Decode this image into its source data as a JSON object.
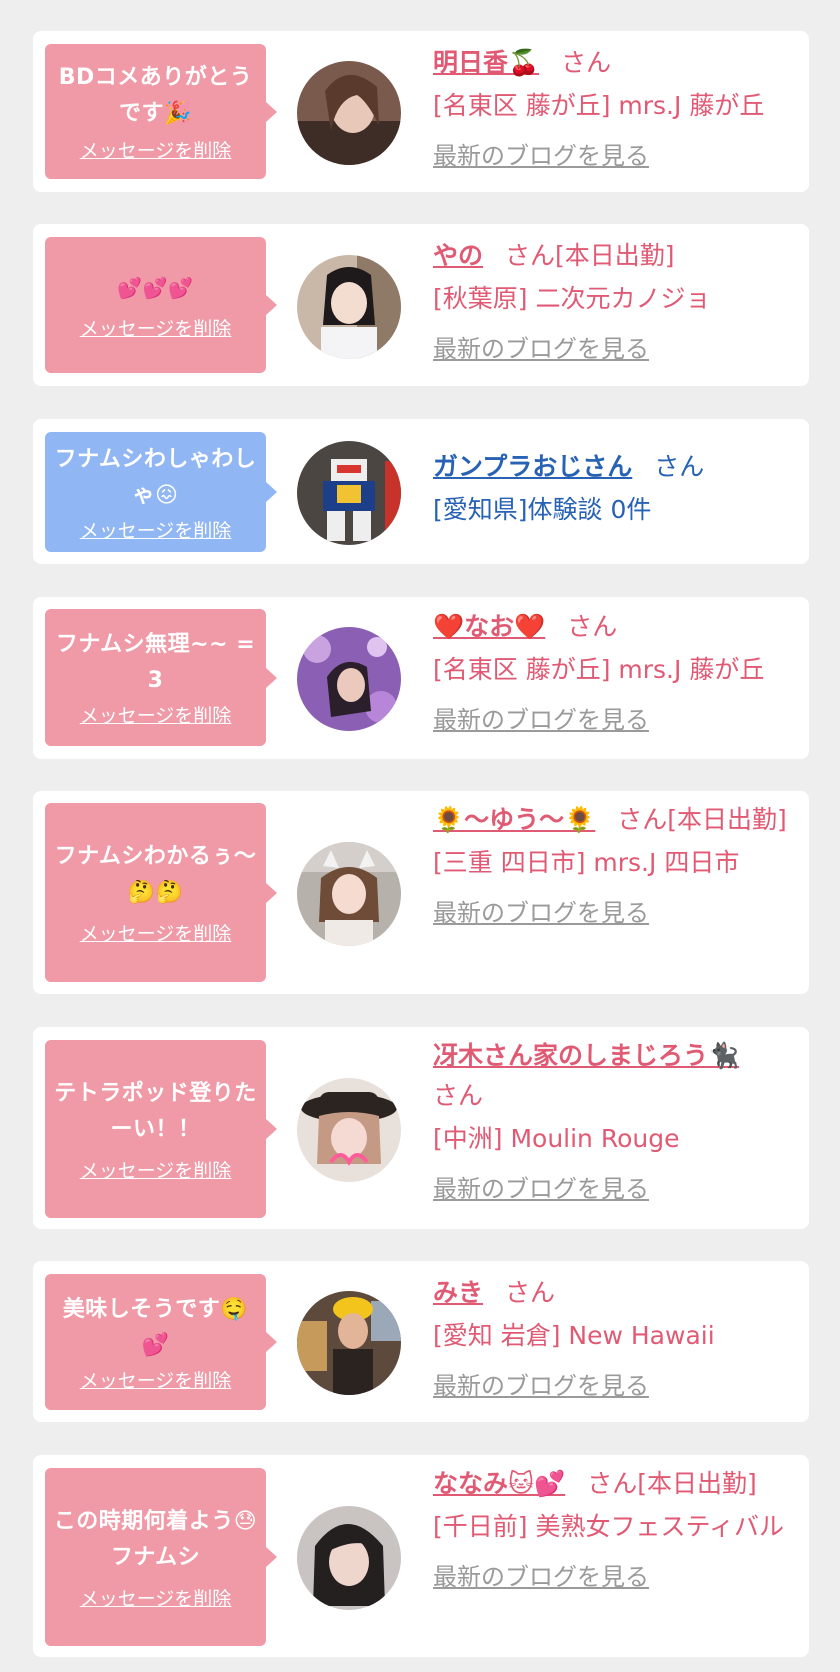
{
  "delete_label": "メッセージを削除",
  "blog_label": "最新のブログを見る",
  "colors": {
    "pink_bubble": "#ef9aa6",
    "blue_bubble": "#90b6f3",
    "pink_text": "#e05a74",
    "blue_text": "#2762b5",
    "gray_link": "#9a9a9a"
  },
  "items": [
    {
      "message": "BDコメありがとうです🎉",
      "name": "明日香🍒",
      "suffix": "さん",
      "shop": "[名東区 藤が丘] mrs.J 藤が丘",
      "avatar": "woman-brown-hair-photo"
    },
    {
      "message": "💕💕💕",
      "name": "やの",
      "suffix": "さん[本日出勤]",
      "shop": "[秋葉原] 二次元カノジョ",
      "avatar": "girl-school-uniform-photo"
    },
    {
      "message": "フナムシわしゃわしゃ😖",
      "name": "ガンプラおじさん",
      "suffix": "さん",
      "shop": "[愛知県]体験談 0件",
      "avatar": "gundam-model-photo"
    },
    {
      "message": "フナムシ無理~~ =3",
      "name": "❤️なお❤️",
      "suffix": "さん",
      "shop": "[名東区 藤が丘] mrs.J 藤が丘",
      "avatar": "woman-purple-flowers-photo"
    },
    {
      "message": "フナムシわかるぅ〜🤔🤔",
      "name": "🌻〜ゆう〜🌻",
      "suffix": "さん[本日出勤]",
      "shop": "[三重 四日市] mrs.J 四日市",
      "avatar": "woman-cat-ears-photo"
    },
    {
      "message": "テトラポッド登りたーい！！",
      "name": "冴木さん家のしまじろう🐈‍⬛",
      "suffix": "さん",
      "shop": "[中洲] Moulin Rouge",
      "avatar": "woman-black-hat-photo"
    },
    {
      "message": "美味しそうです🤤💕",
      "name": "みき",
      "suffix": "さん",
      "shop": "[愛知 岩倉] New Hawaii",
      "avatar": "person-yellow-hat-photo"
    },
    {
      "message": "この時期何着よう😓フナムシ",
      "name": "ななみ🐱💕",
      "suffix": "さん[本日出勤]",
      "shop": "[千日前] 美熟女フェスティバル",
      "avatar": "woman-dark-hair-photo"
    }
  ]
}
